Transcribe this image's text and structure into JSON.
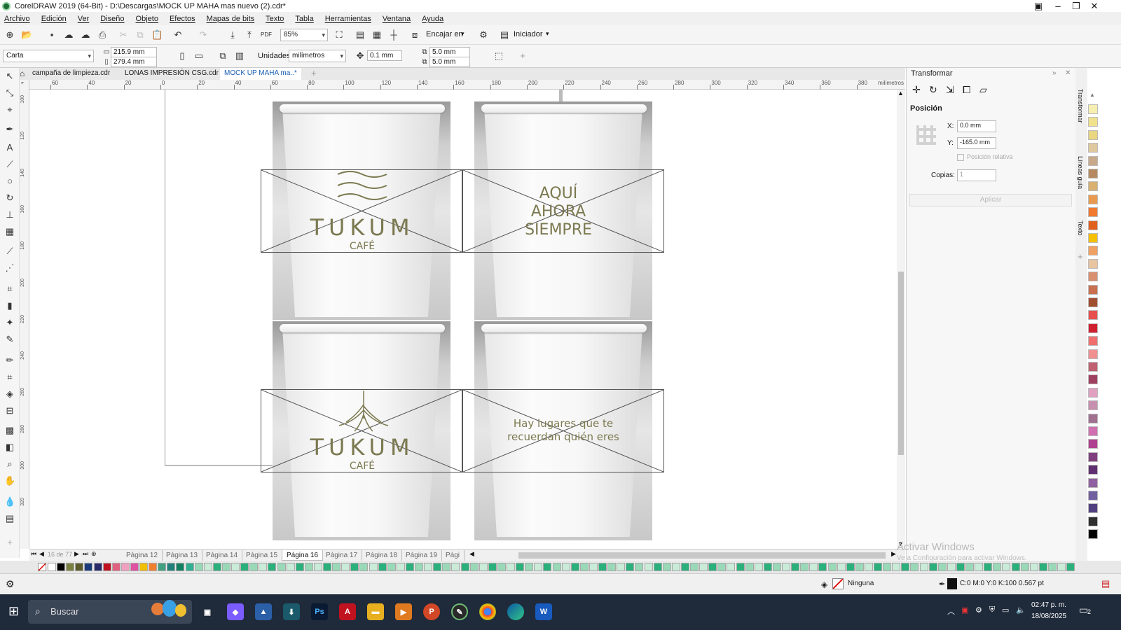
{
  "window": {
    "title": "CorelDRAW 2019 (64-Bit) - D:\\Descargas\\MOCK UP MAHA mas nuevo (2).cdr*"
  },
  "menu": [
    "Archivo",
    "Edición",
    "Ver",
    "Diseño",
    "Objeto",
    "Efectos",
    "Mapas de bits",
    "Texto",
    "Tabla",
    "Herramientas",
    "Ventana",
    "Ayuda"
  ],
  "toolbar": {
    "zoom": "85%",
    "fit_label": "Encajar en",
    "launch_label": "Iniciador"
  },
  "properties": {
    "paper": "Carta",
    "width": "215.9 mm",
    "height": "279.4 mm",
    "units_label": "Unidades:",
    "units": "milímetros",
    "nudge": "0.1 mm",
    "dup_x": "5.0 mm",
    "dup_y": "5.0 mm"
  },
  "tabs": [
    {
      "label": "campaña de limpieza.cdr"
    },
    {
      "label": "LONAS IMPRESIÓN CSG.cdr"
    },
    {
      "label": "MOCK UP MAHA ma..*"
    }
  ],
  "ruler": {
    "ticks": [
      "60",
      "40",
      "20",
      "0",
      "20",
      "40",
      "60",
      "80",
      "100",
      "120",
      "140",
      "160",
      "180",
      "200",
      "220",
      "240",
      "260",
      "280",
      "300",
      "320",
      "340",
      "360",
      "380"
    ],
    "unit": "milímetros",
    "vticks": [
      "100",
      "120",
      "140",
      "160",
      "180",
      "200",
      "220",
      "240",
      "260",
      "280",
      "300",
      "320"
    ]
  },
  "docker": {
    "title": "Transformar",
    "section": "Posición",
    "x_label": "X:",
    "x": "0.0 mm",
    "y_label": "Y:",
    "y": "-165.0 mm",
    "relative": "Posición relativa",
    "copies_label": "Copias:",
    "copies": "1",
    "apply": "Aplicar"
  },
  "docker_tabs": [
    "Transformar",
    "Líneas guía",
    "Texto"
  ],
  "cups": [
    {
      "logo_brand": "TUKUM",
      "logo_sub": "CAFÉ"
    },
    {
      "text_lines": [
        "AQUÍ",
        "AHORA",
        "SIEMPRE"
      ]
    },
    {
      "logo_brand": "TUKUM",
      "logo_sub": "CAFÉ"
    },
    {
      "text_lines": [
        "Hay lugares que te",
        "recuerdan quién eres"
      ]
    }
  ],
  "pagebar": {
    "counter_current": "16",
    "counter_sep": "de",
    "counter_total": "77",
    "pages": [
      "Página 12",
      "Página 13",
      "Página 14",
      "Página 15",
      "Página 16",
      "Página 17",
      "Página 18",
      "Página 19",
      "Pági"
    ],
    "active": "Página 16"
  },
  "watermark": {
    "line1": "Activar Windows",
    "line2": "Ve a Configuración para activar Windows."
  },
  "status": {
    "fill": "Ninguna",
    "outline": "C:0 M:0 Y:0 K:100  0.567 pt"
  },
  "taskbar": {
    "search": "Buscar",
    "time": "02:47 p. m.",
    "date": "18/08/2025",
    "notif": "2"
  },
  "palette_colors": [
    "#f7efb0",
    "#f0e28c",
    "#e8d680",
    "#dfcaa0",
    "#c8a98a",
    "#b58a62",
    "#d8b070",
    "#e89a50",
    "#f07a30",
    "#e06020",
    "#f5c000",
    "#f0a060",
    "#e8c4a0",
    "#d89070",
    "#c87050",
    "#a05030",
    "#e85050",
    "#d02030",
    "#f07070",
    "#f09090",
    "#c06070",
    "#a04060",
    "#e0a0c0",
    "#c890b0",
    "#a07090",
    "#d070b0",
    "#b04090",
    "#804080",
    "#603070",
    "#9060a0",
    "#7060a0",
    "#504080",
    "#303030",
    "#000000"
  ],
  "hpalette_colors": [
    "#ffffff",
    "#000000",
    "#7a8040",
    "#5a5a2a",
    "#1a3a7a",
    "#2a2a6a",
    "#c01020",
    "#e06080",
    "#f0a0c0",
    "#e050a0",
    "#f0c000",
    "#f08030",
    "#40a080",
    "#20807a",
    "#108060",
    "#30b090"
  ]
}
